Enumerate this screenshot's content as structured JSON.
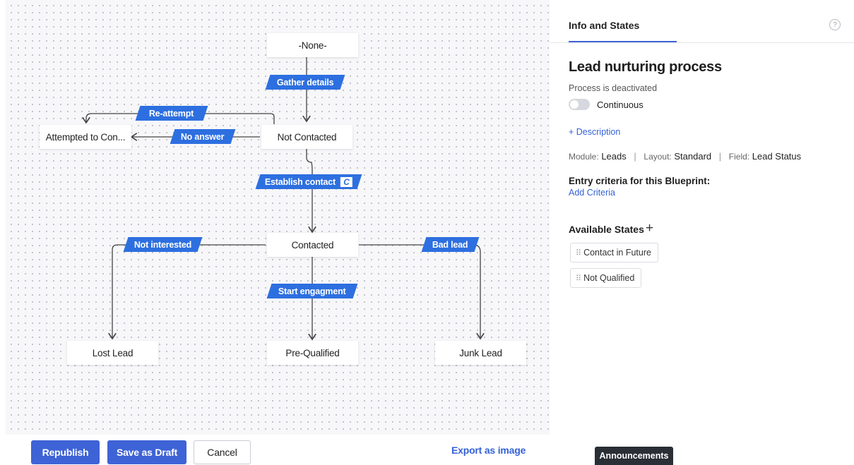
{
  "canvas": {
    "states": [
      {
        "name": "-None-"
      },
      {
        "name": "Attempted to Con..."
      },
      {
        "name": "Not Contacted"
      },
      {
        "name": "Contacted"
      },
      {
        "name": "Lost Lead"
      },
      {
        "name": "Pre-Qualified"
      },
      {
        "name": "Junk Lead"
      }
    ],
    "transitions": [
      {
        "label": "Gather details"
      },
      {
        "label": "Re-attempt"
      },
      {
        "label": "No answer"
      },
      {
        "label": "Establish contact",
        "badge": "C"
      },
      {
        "label": "Not interested"
      },
      {
        "label": "Bad lead"
      },
      {
        "label": "Start engagment"
      }
    ]
  },
  "footer": {
    "republish": "Republish",
    "save_draft": "Save as Draft",
    "cancel": "Cancel",
    "export": "Export as image",
    "announcements": "Announcements"
  },
  "panel": {
    "tab": "Info and States",
    "help_icon": "?",
    "title": "Lead nurturing process",
    "status": "Process is deactivated",
    "toggle_label": "Continuous",
    "toggle_on": false,
    "add_description": "+ Description",
    "module_label": "Module:",
    "module_value": "Leads",
    "layout_label": "Layout:",
    "layout_value": "Standard",
    "field_label": "Field:",
    "field_value": "Lead Status",
    "entry_title": "Entry criteria for this Blueprint:",
    "add_criteria": "Add Criteria",
    "available_title": "Available States",
    "available_plus": "+",
    "available_states": [
      "Contact in Future",
      "Not Qualified"
    ]
  },
  "colors": {
    "accent": "#3e63d6",
    "transition": "#2d6fe0",
    "link": "#3461d6"
  }
}
